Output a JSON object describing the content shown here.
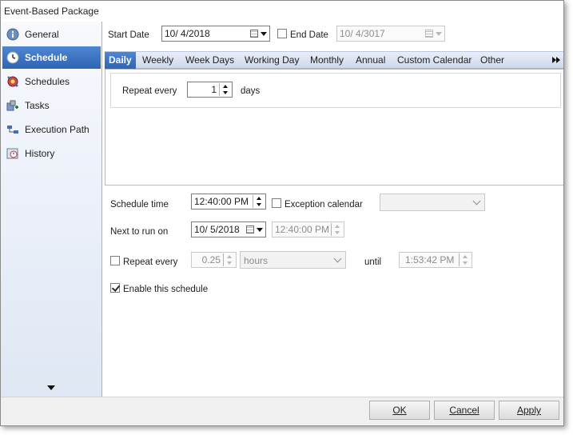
{
  "window": {
    "title": "Event-Based Package"
  },
  "sidebar": {
    "items": [
      {
        "label": "General",
        "icon": "info-icon"
      },
      {
        "label": "Schedule",
        "icon": "clock-icon",
        "active": true
      },
      {
        "label": "Schedules",
        "icon": "schedules-gear-icon"
      },
      {
        "label": "Tasks",
        "icon": "tasks-icon"
      },
      {
        "label": "Execution Path",
        "icon": "execution-path-icon"
      },
      {
        "label": "History",
        "icon": "history-icon"
      }
    ]
  },
  "dates": {
    "start_label": "Start Date",
    "start_value": "10/  4/2018",
    "end_label": "End Date",
    "end_value": "10/  4/3017",
    "end_checked": false
  },
  "tabs": {
    "items": [
      "Daily",
      "Weekly",
      "Week Days",
      "Working Day",
      "Monthly",
      "Annual",
      "Custom Calendar",
      "Other"
    ],
    "active": "Daily"
  },
  "daily": {
    "repeat_label": "Repeat every",
    "repeat_value": "1",
    "unit": "days"
  },
  "schedule": {
    "time_label": "Schedule time",
    "time_value": "12:40:00 PM",
    "exception_label": "Exception calendar",
    "exception_checked": false,
    "exception_value": "",
    "next_label": "Next to run on",
    "next_date": "10/  5/2018",
    "next_time": "12:40:00 PM",
    "repeat_label": "Repeat every",
    "repeat_checked": false,
    "repeat_value": "0.25",
    "repeat_unit": "hours",
    "until_label": "until",
    "until_value": "1:53:42 PM",
    "enable_label": "Enable this schedule",
    "enable_checked": true
  },
  "footer": {
    "ok": "OK",
    "cancel": "Cancel",
    "apply": "Apply"
  },
  "colors": {
    "accent": "#2e64b5",
    "sidebar_bg": "#dfe7f4"
  }
}
